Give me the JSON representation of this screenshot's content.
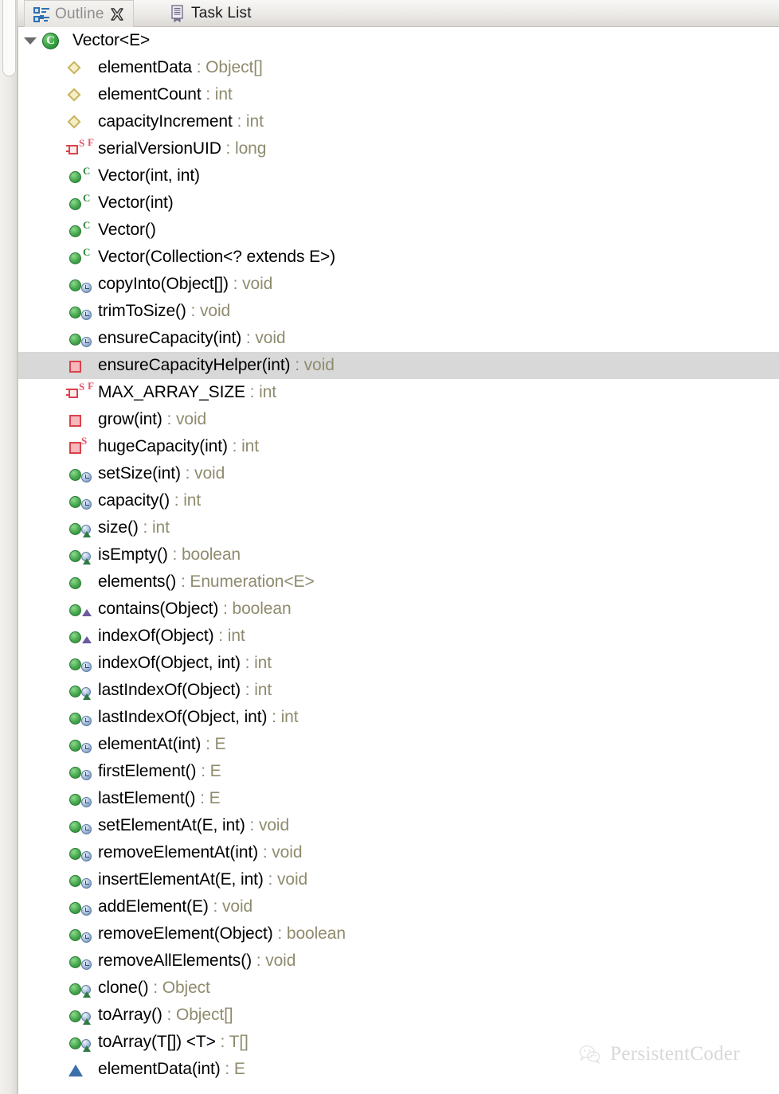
{
  "window": {
    "view_type": "eclipse-outline-view"
  },
  "tabs": [
    {
      "label": "Outline",
      "icon": "outline-icon",
      "active": true,
      "closable": true
    },
    {
      "label": "Task List",
      "icon": "task-list-icon",
      "active": false,
      "closable": false
    }
  ],
  "tab_close_icon": "close-icon",
  "colors": {
    "selection_background": "#d8d8d8",
    "return_type_text": "#8f8b6e",
    "member_text": "#000000",
    "public_icon": "#45a84d",
    "private_icon": "#d9434b",
    "protected_icon": "#c9b35e",
    "default_icon": "#3d6fa8",
    "tab_active_label": "#8d8d8d",
    "tab_inactive_label": "#1a1a1a"
  },
  "tree": {
    "root": {
      "label": "Vector<E>",
      "icon": "java-class-icon",
      "expanded": true,
      "twisty": "chevron-down-icon"
    },
    "items": [
      {
        "name": "elementData",
        "type": "Object[]",
        "icon": "protected-field-icon",
        "badges": [],
        "selected": false
      },
      {
        "name": "elementCount",
        "type": "int",
        "icon": "protected-field-icon",
        "badges": [],
        "selected": false
      },
      {
        "name": "capacityIncrement",
        "type": "int",
        "icon": "protected-field-icon",
        "badges": [],
        "selected": false
      },
      {
        "name": "serialVersionUID",
        "type": "long",
        "icon": "private-field-icon",
        "badges": [
          "static",
          "final"
        ],
        "selected": false
      },
      {
        "name": "Vector(int, int)",
        "type": "",
        "icon": "public-method-icon",
        "badges": [
          "constructor"
        ],
        "selected": false
      },
      {
        "name": "Vector(int)",
        "type": "",
        "icon": "public-method-icon",
        "badges": [
          "constructor"
        ],
        "selected": false
      },
      {
        "name": "Vector()",
        "type": "",
        "icon": "public-method-icon",
        "badges": [
          "constructor"
        ],
        "selected": false
      },
      {
        "name": "Vector(Collection<? extends E>)",
        "type": "",
        "icon": "public-method-icon",
        "badges": [
          "constructor"
        ],
        "selected": false
      },
      {
        "name": "copyInto(Object[])",
        "type": "void",
        "icon": "public-method-icon",
        "badges": [
          "synchronized"
        ],
        "selected": false
      },
      {
        "name": "trimToSize()",
        "type": "void",
        "icon": "public-method-icon",
        "badges": [
          "synchronized"
        ],
        "selected": false
      },
      {
        "name": "ensureCapacity(int)",
        "type": "void",
        "icon": "public-method-icon",
        "badges": [
          "synchronized"
        ],
        "selected": false
      },
      {
        "name": "ensureCapacityHelper(int)",
        "type": "void",
        "icon": "private-method-icon",
        "badges": [],
        "selected": true
      },
      {
        "name": "MAX_ARRAY_SIZE",
        "type": "int",
        "icon": "private-field-icon",
        "badges": [
          "static",
          "final"
        ],
        "selected": false
      },
      {
        "name": "grow(int)",
        "type": "void",
        "icon": "private-method-icon",
        "badges": [],
        "selected": false
      },
      {
        "name": "hugeCapacity(int)",
        "type": "int",
        "icon": "private-method-icon",
        "badges": [
          "static"
        ],
        "selected": false
      },
      {
        "name": "setSize(int)",
        "type": "void",
        "icon": "public-method-icon",
        "badges": [
          "synchronized"
        ],
        "selected": false
      },
      {
        "name": "capacity()",
        "type": "int",
        "icon": "public-method-icon",
        "badges": [
          "synchronized"
        ],
        "selected": false
      },
      {
        "name": "size()",
        "type": "int",
        "icon": "public-method-icon",
        "badges": [
          "synchronized",
          "implements"
        ],
        "selected": false
      },
      {
        "name": "isEmpty()",
        "type": "boolean",
        "icon": "public-method-icon",
        "badges": [
          "synchronized",
          "implements"
        ],
        "selected": false
      },
      {
        "name": "elements()",
        "type": "Enumeration<E>",
        "icon": "public-method-icon",
        "badges": [],
        "selected": false
      },
      {
        "name": "contains(Object)",
        "type": "boolean",
        "icon": "public-method-icon",
        "badges": [
          "implements"
        ],
        "selected": false
      },
      {
        "name": "indexOf(Object)",
        "type": "int",
        "icon": "public-method-icon",
        "badges": [
          "implements"
        ],
        "selected": false
      },
      {
        "name": "indexOf(Object, int)",
        "type": "int",
        "icon": "public-method-icon",
        "badges": [
          "synchronized"
        ],
        "selected": false
      },
      {
        "name": "lastIndexOf(Object)",
        "type": "int",
        "icon": "public-method-icon",
        "badges": [
          "synchronized",
          "implements"
        ],
        "selected": false
      },
      {
        "name": "lastIndexOf(Object, int)",
        "type": "int",
        "icon": "public-method-icon",
        "badges": [
          "synchronized"
        ],
        "selected": false
      },
      {
        "name": "elementAt(int)",
        "type": "E",
        "icon": "public-method-icon",
        "badges": [
          "synchronized"
        ],
        "selected": false
      },
      {
        "name": "firstElement()",
        "type": "E",
        "icon": "public-method-icon",
        "badges": [
          "synchronized"
        ],
        "selected": false
      },
      {
        "name": "lastElement()",
        "type": "E",
        "icon": "public-method-icon",
        "badges": [
          "synchronized"
        ],
        "selected": false
      },
      {
        "name": "setElementAt(E, int)",
        "type": "void",
        "icon": "public-method-icon",
        "badges": [
          "synchronized"
        ],
        "selected": false
      },
      {
        "name": "removeElementAt(int)",
        "type": "void",
        "icon": "public-method-icon",
        "badges": [
          "synchronized"
        ],
        "selected": false
      },
      {
        "name": "insertElementAt(E, int)",
        "type": "void",
        "icon": "public-method-icon",
        "badges": [
          "synchronized"
        ],
        "selected": false
      },
      {
        "name": "addElement(E)",
        "type": "void",
        "icon": "public-method-icon",
        "badges": [
          "synchronized"
        ],
        "selected": false
      },
      {
        "name": "removeElement(Object)",
        "type": "boolean",
        "icon": "public-method-icon",
        "badges": [
          "synchronized"
        ],
        "selected": false
      },
      {
        "name": "removeAllElements()",
        "type": "void",
        "icon": "public-method-icon",
        "badges": [
          "synchronized"
        ],
        "selected": false
      },
      {
        "name": "clone()",
        "type": "Object",
        "icon": "public-method-icon",
        "badges": [
          "synchronized",
          "implements"
        ],
        "selected": false
      },
      {
        "name": "toArray()",
        "type": "Object[]",
        "icon": "public-method-icon",
        "badges": [
          "synchronized",
          "implements"
        ],
        "selected": false
      },
      {
        "name": "toArray(T[]) <T>",
        "type": "T[]",
        "icon": "public-method-icon",
        "badges": [
          "synchronized",
          "implements"
        ],
        "selected": false
      },
      {
        "name": "elementData(int)",
        "type": "E",
        "icon": "default-method-icon",
        "badges": [],
        "selected": false
      }
    ]
  },
  "watermark": {
    "text": "PersistentCoder",
    "icon": "wechat-logo-icon"
  }
}
